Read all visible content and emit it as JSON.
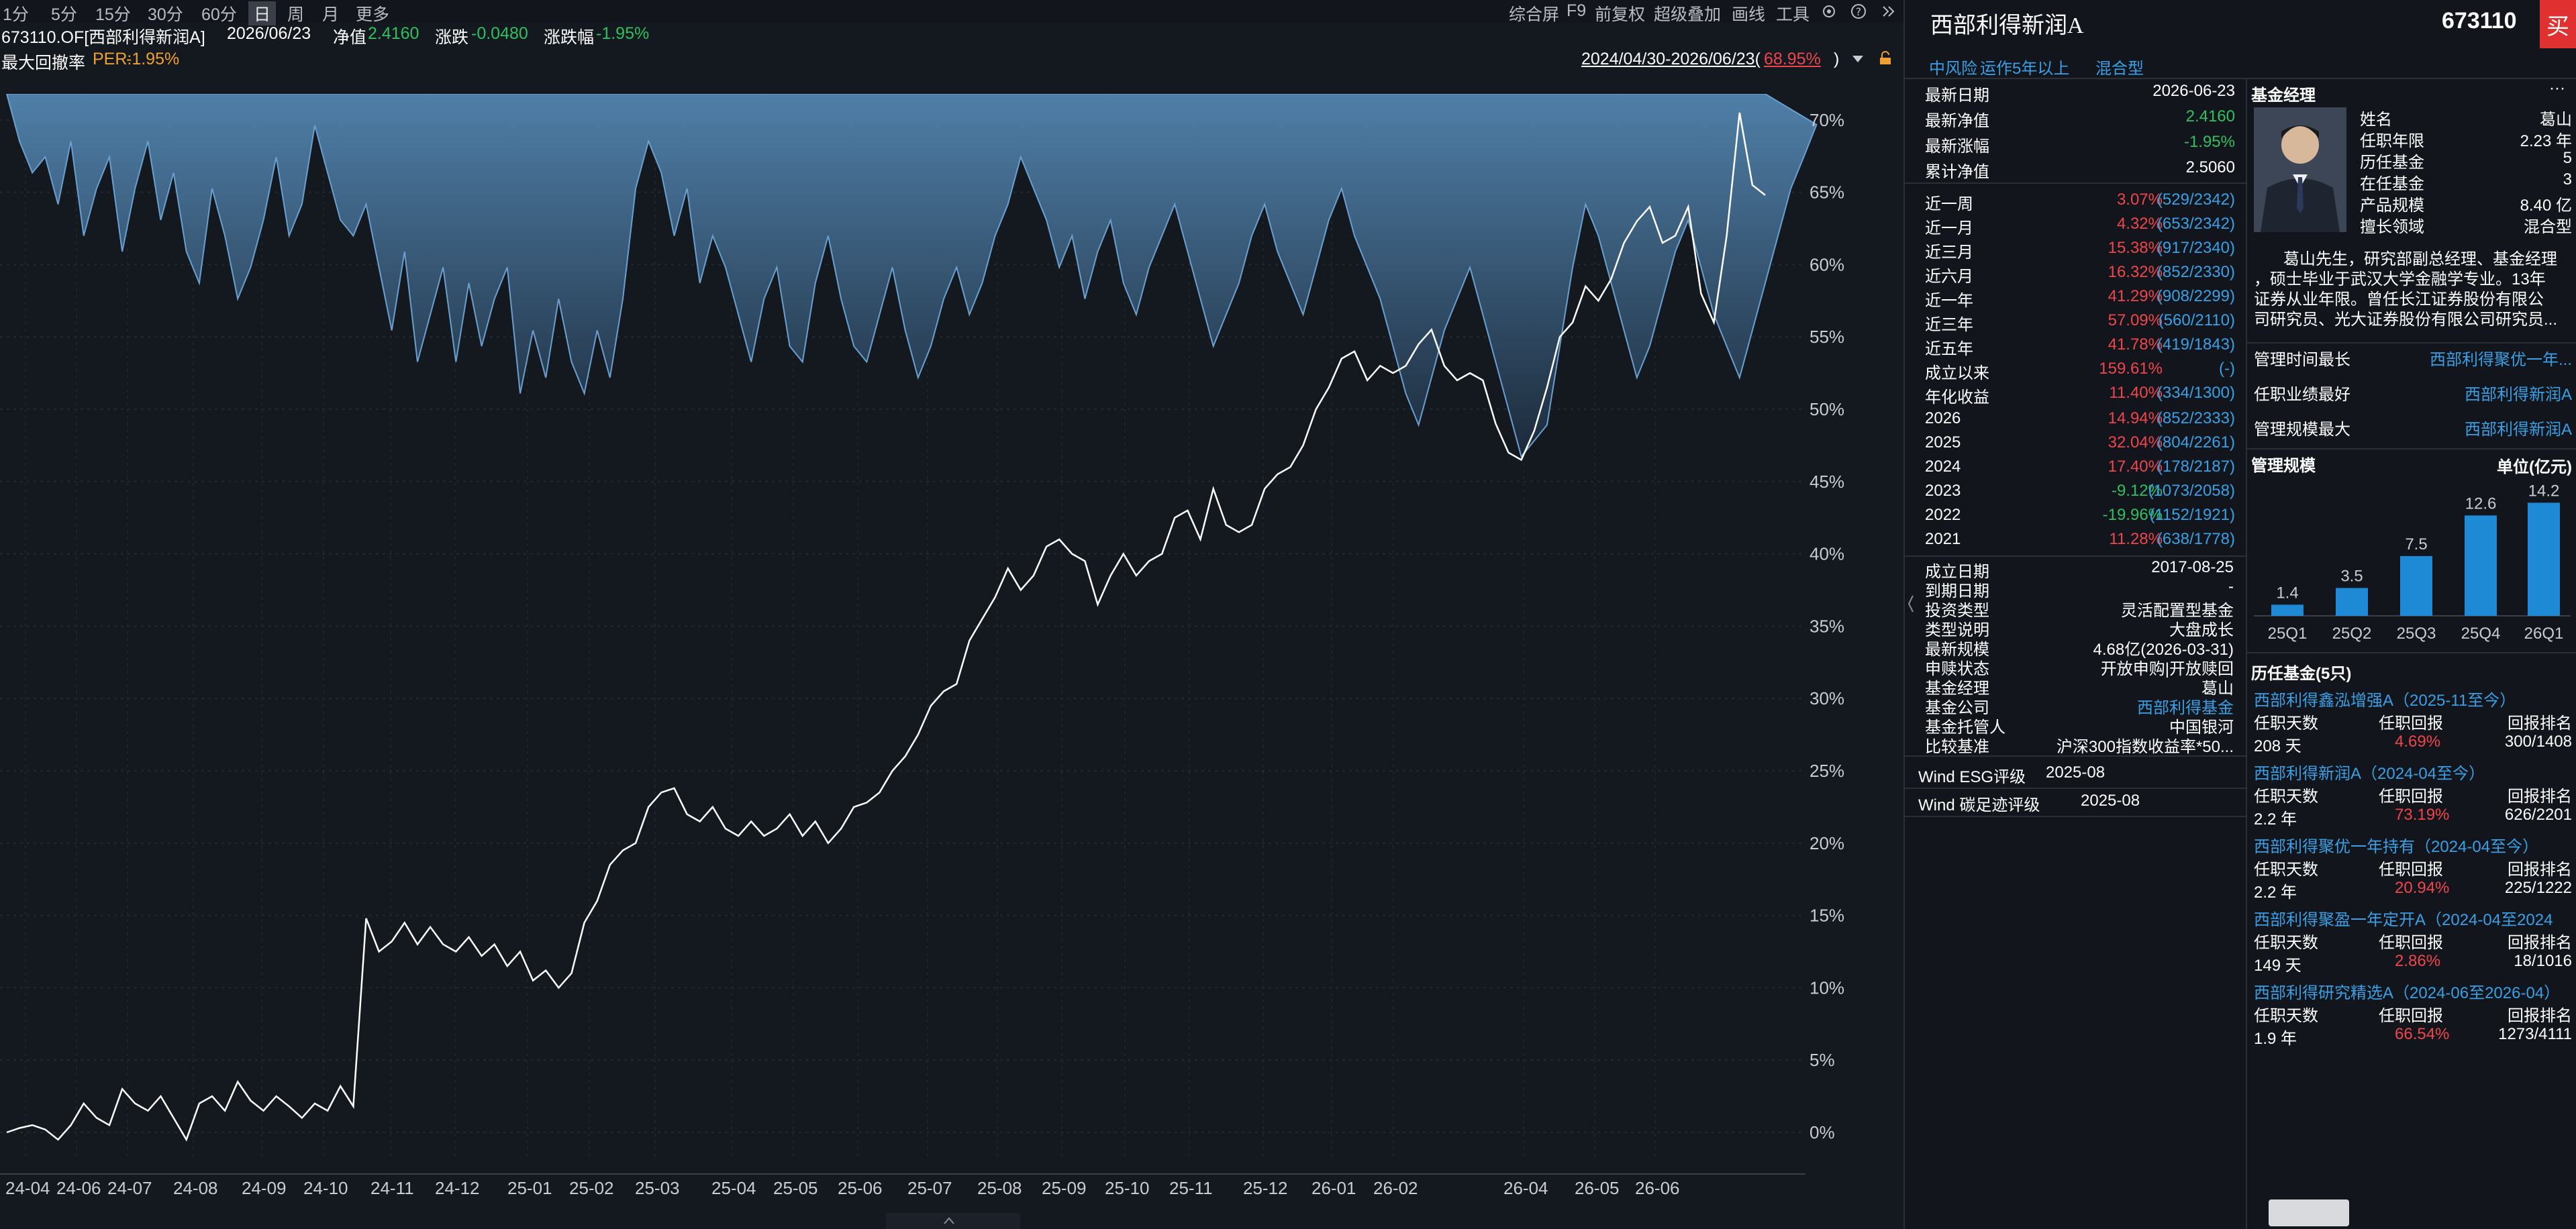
{
  "toolbar": {
    "periods": [
      "1分",
      "5分",
      "15分",
      "30分",
      "60分",
      "日",
      "周",
      "月",
      "更多"
    ],
    "active_period": "日",
    "right_items": [
      "综合屏",
      "F9",
      "前复权",
      "超级叠加",
      "画线",
      "工具"
    ]
  },
  "info": {
    "code": "673110.OF[西部利得新润A]",
    "date": "2026/06/23",
    "nav_label": "净值",
    "nav_value": "2.4160",
    "change_label": "涨跌",
    "change_value": "-0.0480",
    "pct_label": "涨跌幅",
    "pct_value": "-1.95%"
  },
  "drawdown": {
    "label": "最大回撤率",
    "per_label": "PER:",
    "per_value": "-1.95%",
    "range_text": "2024/04/30-2026/06/23(",
    "range_pct": "68.95%",
    "range_close": ")"
  },
  "chart_data": {
    "type": "line",
    "x_tick_labels": [
      "24-04",
      "24-06",
      "24-07",
      "24-08",
      "24-09",
      "24-10",
      "24-11",
      "24-12",
      "25-01",
      "25-02",
      "25-03",
      "25-04",
      "25-05",
      "25-06",
      "25-07",
      "25-08",
      "25-09",
      "25-10",
      "25-11",
      "25-12",
      "26-01",
      "26-02",
      "26-04",
      "26-05",
      "26-06"
    ],
    "y_tick_labels": [
      "70%",
      "65%",
      "60%",
      "55%",
      "50%",
      "45%",
      "40%",
      "35%",
      "30%",
      "25%",
      "20%",
      "15%",
      "10%",
      "5%",
      "0%"
    ],
    "ylim": [
      0,
      72
    ],
    "series": [
      {
        "values": [
          0,
          0.3,
          0.5,
          0.2,
          -0.5,
          0.5,
          2,
          1,
          0.5,
          3,
          2,
          1.5,
          2.5,
          1,
          -0.5,
          2,
          2.5,
          1.5,
          3.5,
          2.2,
          1.5,
          2.5,
          1.8,
          1,
          2,
          1.5,
          3.2,
          1.8,
          14.8,
          12.5,
          13.2,
          14.5,
          13,
          14.2,
          13,
          12.5,
          13.5,
          12.2,
          13,
          11.5,
          12.5,
          10.5,
          11.2,
          10,
          11,
          14.5,
          16,
          18.5,
          19.5,
          20,
          22.5,
          23.5,
          23.8,
          22,
          21.5,
          22.5,
          21,
          20.5,
          21.5,
          20.5,
          21,
          22,
          20.5,
          21.5,
          20,
          21,
          22.5,
          22.8,
          23.5,
          25,
          26,
          27.5,
          29.5,
          30.5,
          31,
          34,
          35.5,
          37,
          39,
          37.5,
          38.5,
          40.5,
          41,
          40,
          39.5,
          36.5,
          38.5,
          40,
          38.5,
          39.5,
          40,
          42.5,
          43,
          41,
          44.5,
          42,
          41.5,
          42,
          44.5,
          45.5,
          46,
          47.5,
          50,
          51.5,
          53.5,
          54,
          52,
          53,
          52.5,
          53,
          54.5,
          55.5,
          53,
          52,
          52.5,
          52,
          49,
          47,
          46.5,
          48.5,
          51.5,
          55,
          56,
          58.5,
          57.5,
          59,
          61.5,
          63,
          64,
          61.5,
          62,
          64,
          58,
          56,
          62,
          70.5,
          65.5,
          64.8
        ]
      },
      {
        "name": "最大回撤率",
        "values": [
          0,
          -3,
          -5,
          -4,
          -7,
          -3,
          -9,
          -6,
          -4,
          -10,
          -6,
          -3,
          -8,
          -5,
          -10,
          -12,
          -6,
          -9,
          -13,
          -11,
          -8,
          -4,
          -9,
          -7,
          -2,
          -5,
          -8,
          -9,
          -7,
          -11,
          -15,
          -10,
          -17,
          -14,
          -11,
          -17,
          -12,
          -16,
          -13,
          -11,
          -19,
          -15,
          -18,
          -13,
          -17,
          -19,
          -15,
          -18,
          -13,
          -6,
          -3,
          -5,
          -9,
          -6,
          -12,
          -9,
          -11,
          -14,
          -17,
          -13,
          -11,
          -16,
          -17,
          -12,
          -9,
          -13,
          -16,
          -17,
          -14,
          -11,
          -15,
          -18,
          -16,
          -13,
          -11,
          -14,
          -12,
          -9,
          -7,
          -4,
          -6,
          -8,
          -11,
          -9,
          -13,
          -10,
          -8,
          -12,
          -14,
          -11,
          -9,
          -7,
          -10,
          -13,
          -16,
          -14,
          -12,
          -9,
          -7,
          -10,
          -12,
          -14,
          -11,
          -8,
          -6,
          -9,
          -11,
          -13,
          -16,
          -19,
          -21,
          -18,
          -15,
          -13,
          -11,
          -14,
          -17,
          -20,
          -23,
          -22,
          -21,
          -16,
          -11,
          -7,
          -9,
          -12,
          -15,
          -18,
          -16,
          -13,
          -10,
          -8,
          -11,
          -14,
          -16,
          -18,
          -15,
          -12,
          -9,
          -6,
          -4,
          -1.95
        ]
      }
    ]
  },
  "fund": {
    "name": "西部利得新润A",
    "code": "673110",
    "buy_label": "买",
    "tags": [
      "中风险",
      "运作5年以上",
      "混合型"
    ]
  },
  "latest": [
    {
      "label": "最新日期",
      "value": "2026-06-23",
      "color": "white"
    },
    {
      "label": "最新净值",
      "value": "2.4160",
      "color": "green"
    },
    {
      "label": "最新涨幅",
      "value": "-1.95%",
      "color": "green"
    },
    {
      "label": "累计净值",
      "value": "2.5060",
      "color": "white"
    }
  ],
  "returns": [
    {
      "label": "近一周",
      "value": "3.07%",
      "rank": "(529/2342)",
      "color": "red"
    },
    {
      "label": "近一月",
      "value": "4.32%",
      "rank": "(653/2342)",
      "color": "red"
    },
    {
      "label": "近三月",
      "value": "15.38%",
      "rank": "(917/2340)",
      "color": "red"
    },
    {
      "label": "近六月",
      "value": "16.32%",
      "rank": "(852/2330)",
      "color": "red"
    },
    {
      "label": "近一年",
      "value": "41.29%",
      "rank": "(908/2299)",
      "color": "red"
    },
    {
      "label": "近三年",
      "value": "57.09%",
      "rank": "(560/2110)",
      "color": "red"
    },
    {
      "label": "近五年",
      "value": "41.78%",
      "rank": "(419/1843)",
      "color": "red"
    },
    {
      "label": "成立以来",
      "value": "159.61%",
      "rank": "(-)",
      "color": "red"
    },
    {
      "label": "年化收益",
      "value": "11.40%",
      "rank": "(334/1300)",
      "color": "red"
    }
  ],
  "yearly": [
    {
      "label": "2026",
      "value": "14.94%",
      "rank": "(852/2333)",
      "color": "red"
    },
    {
      "label": "2025",
      "value": "32.04%",
      "rank": "(804/2261)",
      "color": "red"
    },
    {
      "label": "2024",
      "value": "17.40%",
      "rank": "(178/2187)",
      "color": "red"
    },
    {
      "label": "2023",
      "value": "-9.12%",
      "rank": "(1073/2058)",
      "color": "green"
    },
    {
      "label": "2022",
      "value": "-19.96%",
      "rank": "(1152/1921)",
      "color": "green"
    },
    {
      "label": "2021",
      "value": "11.28%",
      "rank": "(638/1778)",
      "color": "red"
    }
  ],
  "basic": [
    {
      "label": "成立日期",
      "value": "2017-08-25",
      "color": "white"
    },
    {
      "label": "到期日期",
      "value": "-",
      "color": "white"
    },
    {
      "label": "投资类型",
      "value": "灵活配置型基金",
      "color": "white"
    },
    {
      "label": "类型说明",
      "value": "大盘成长",
      "color": "white"
    },
    {
      "label": "最新规模",
      "value": "4.68亿(2026-03-31)",
      "color": "white"
    },
    {
      "label": "申赎状态",
      "value": "开放申购|开放赎回",
      "color": "white"
    },
    {
      "label": "基金经理",
      "value": "葛山",
      "color": "white"
    },
    {
      "label": "基金公司",
      "value": "西部利得基金",
      "color": "blue"
    },
    {
      "label": "基金托管人",
      "value": "中国银河",
      "color": "white"
    },
    {
      "label": "比较基准",
      "value": "沪深300指数收益率*50...",
      "color": "white"
    }
  ],
  "ratings": [
    {
      "label": "Wind ESG评级",
      "value": "2025-08"
    },
    {
      "label": "Wind 碳足迹评级",
      "value": "2025-08"
    }
  ],
  "manager": {
    "section_title": "基金经理",
    "more": "···",
    "fields": [
      {
        "label": "姓名",
        "value": "葛山"
      },
      {
        "label": "任职年限",
        "value": "2.23 年"
      },
      {
        "label": "历任基金",
        "value": "5"
      },
      {
        "label": "在任基金",
        "value": "3"
      },
      {
        "label": "产品规模",
        "value": "8.40 亿"
      },
      {
        "label": "擅长领域",
        "value": "混合型"
      }
    ],
    "bio_lines": [
      "葛山先生，研究部副总经理、基金经理",
      "，硕士毕业于武汉大学金融学专业。13年",
      "证券从业年限。曾任长江证券股份有限公",
      "司研究员、光大证券股份有限公司研究员..."
    ],
    "bests": [
      {
        "label": "管理时间最长",
        "value": "西部利得聚优一年..."
      },
      {
        "label": "任职业绩最好",
        "value": "西部利得新润A"
      },
      {
        "label": "管理规模最大",
        "value": "西部利得新润A"
      }
    ],
    "scale_title": "管理规模",
    "scale_unit": "单位(亿元)",
    "scale_chart": {
      "categories": [
        "25Q1",
        "25Q2",
        "25Q3",
        "25Q4",
        "26Q1"
      ],
      "values": [
        1.4,
        3.5,
        7.5,
        12.6,
        14.2
      ],
      "value_labels": [
        "1.4",
        "3.5",
        "7.5",
        "12.6",
        "14.2"
      ]
    },
    "history_title": "历任基金(5只)",
    "history_headers": [
      "任职天数",
      "任职回报",
      "回报排名"
    ],
    "history": [
      {
        "name": "西部利得鑫泓增强A（2025-11至今）",
        "days": "208 天",
        "ret": "4.69%",
        "rank": "300/1408"
      },
      {
        "name": "西部利得新润A（2024-04至今）",
        "days": "2.2 年",
        "ret": "73.19%",
        "rank": "626/2201"
      },
      {
        "name": "西部利得聚优一年持有（2024-04至今）",
        "days": "2.2 年",
        "ret": "20.94%",
        "rank": "225/1222"
      },
      {
        "name": "西部利得聚盈一年定开A（2024-04至2024",
        "days": "149 天",
        "ret": "2.86%",
        "rank": "18/1016"
      },
      {
        "name": "西部利得研究精选A（2024-06至2026-04）",
        "days": "1.9 年",
        "ret": "66.54%",
        "rank": "1273/4111"
      }
    ]
  }
}
